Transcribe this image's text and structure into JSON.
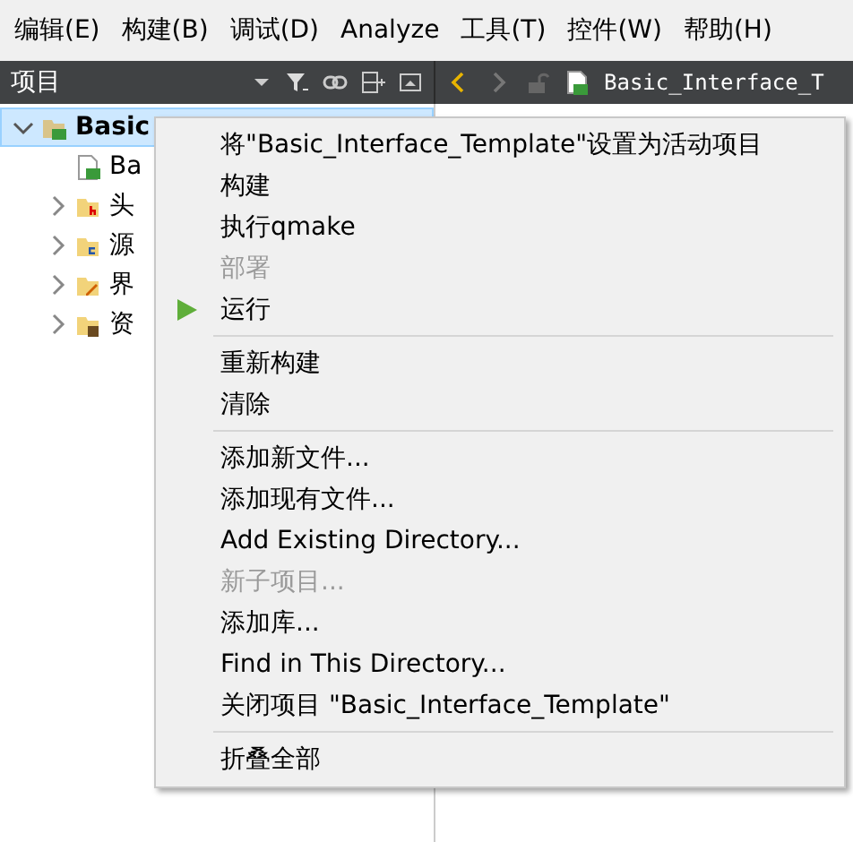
{
  "menubar": [
    {
      "label": "编辑(E)"
    },
    {
      "label": "构建(B)"
    },
    {
      "label": "调试(D)"
    },
    {
      "label": "Analyze"
    },
    {
      "label": "工具(T)"
    },
    {
      "label": "控件(W)"
    },
    {
      "label": "帮助(H)"
    }
  ],
  "projects_panel": {
    "title": "项目"
  },
  "editor_toolbar": {
    "file_name": "Basic_Interface_T"
  },
  "tree": [
    {
      "label": "Basic",
      "kind": "project",
      "expanded": true,
      "selected": true,
      "children": [
        {
          "label": "Ba",
          "kind": "pro-file",
          "selected": false
        },
        {
          "label": "头",
          "kind": "header-folder",
          "expanded": false,
          "selected": false
        },
        {
          "label": "源",
          "kind": "source-folder",
          "expanded": false,
          "selected": false
        },
        {
          "label": "界",
          "kind": "form-folder",
          "expanded": false,
          "selected": false
        },
        {
          "label": "资",
          "kind": "resource-folder",
          "expanded": false,
          "selected": false
        }
      ]
    }
  ],
  "context_menu": [
    {
      "kind": "item",
      "label": "将\"Basic_Interface_Template\"设置为活动项目",
      "disabled": false
    },
    {
      "kind": "item",
      "label": "构建",
      "disabled": false
    },
    {
      "kind": "item",
      "label": "执行qmake",
      "disabled": false
    },
    {
      "kind": "item",
      "label": "部署",
      "disabled": true
    },
    {
      "kind": "run",
      "label": "运行",
      "disabled": false
    },
    {
      "kind": "separator"
    },
    {
      "kind": "item",
      "label": "重新构建",
      "disabled": false
    },
    {
      "kind": "item",
      "label": "清除",
      "disabled": false
    },
    {
      "kind": "separator"
    },
    {
      "kind": "item",
      "label": "添加新文件...",
      "disabled": false
    },
    {
      "kind": "item",
      "label": "添加现有文件...",
      "disabled": false
    },
    {
      "kind": "item",
      "label": "Add Existing Directory...",
      "disabled": false
    },
    {
      "kind": "item",
      "label": "新子项目...",
      "disabled": true
    },
    {
      "kind": "item",
      "label": "添加库...",
      "disabled": false
    },
    {
      "kind": "item",
      "label": "Find in This Directory...",
      "disabled": false
    },
    {
      "kind": "item",
      "label": "关闭项目 \"Basic_Interface_Template\"",
      "disabled": false
    },
    {
      "kind": "separator"
    },
    {
      "kind": "item",
      "label": "折叠全部",
      "disabled": false
    }
  ]
}
